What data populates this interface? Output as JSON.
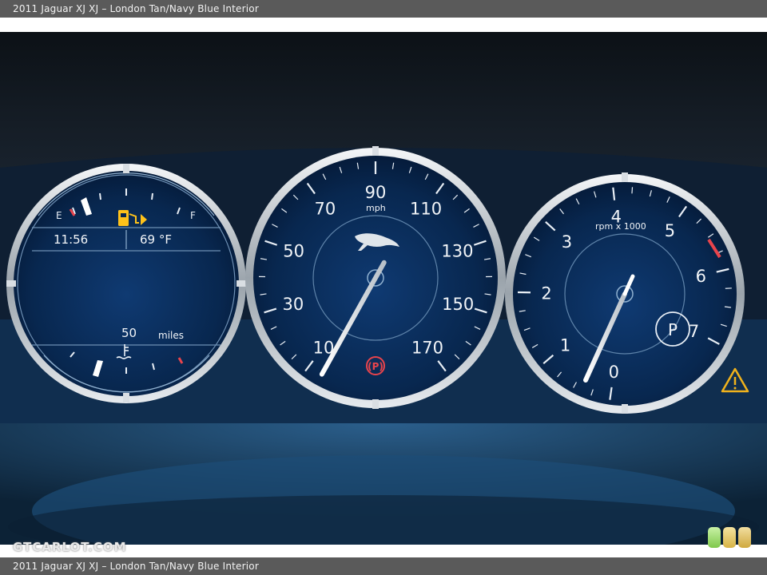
{
  "caption": "2011 Jaguar XJ XJ – London Tan/Navy Blue Interior",
  "watermark": "GTCARLOT.COM",
  "left_gauge": {
    "fuel_empty": "E",
    "fuel_full": "F",
    "fuel_icon": "fuel-pump-icon",
    "time": "11:56",
    "temperature": "69 °F",
    "range_value": "50",
    "range_unit": "miles",
    "coolant_icon": "coolant-temp-icon"
  },
  "speedometer": {
    "unit": "mph",
    "labels": [
      "10",
      "30",
      "50",
      "70",
      "90",
      "110",
      "130",
      "150",
      "170"
    ],
    "needle_value_mph": 6,
    "brake_indicator": "(P)",
    "brake_icon": "parking-brake-icon",
    "logo": "jaguar-leaper-logo"
  },
  "tachometer": {
    "unit": "rpm x 1000",
    "labels": [
      "0",
      "1",
      "2",
      "3",
      "4",
      "5",
      "6",
      "7"
    ],
    "gear": "P",
    "warning_icon": "warning-triangle-icon"
  },
  "colors": {
    "dial_blue": "#0a2a55",
    "ring_silver": "#d9dee3",
    "redline": "#e8444c",
    "fuel_amber": "#ffc21a",
    "warning_amber": "#f0b21c"
  }
}
